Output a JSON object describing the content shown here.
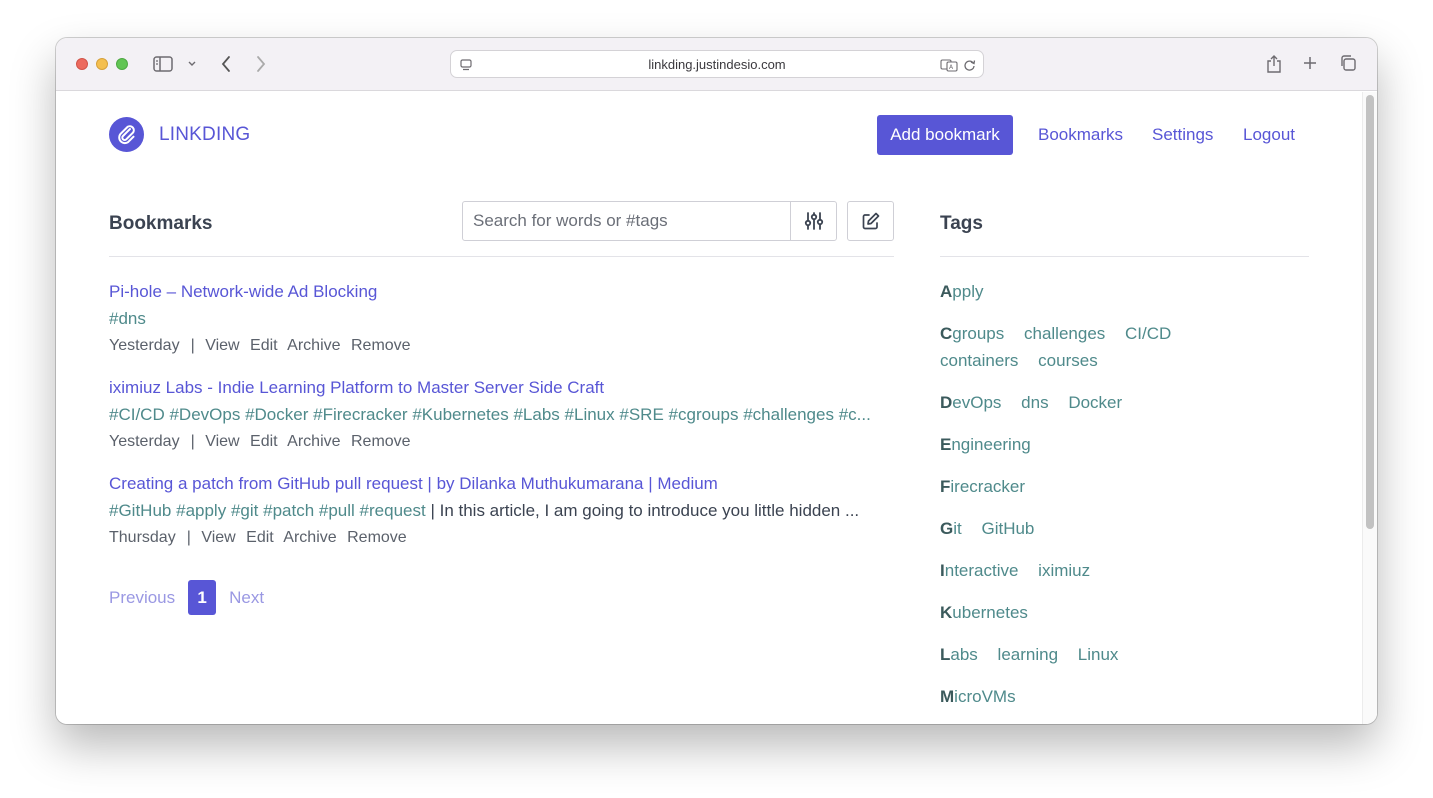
{
  "browser": {
    "url": "linkding.justindesio.com"
  },
  "header": {
    "brand": "LINKDING",
    "add_bookmark": "Add bookmark",
    "nav": [
      "Bookmarks",
      "Settings",
      "Logout"
    ]
  },
  "bookmarks_section": {
    "title": "Bookmarks",
    "search_placeholder": "Search for words or #tags"
  },
  "bookmarks": [
    {
      "title": "Pi-hole – Network-wide Ad Blocking",
      "tags": [
        "#dns"
      ],
      "description": "",
      "date": "Yesterday",
      "actions": [
        "View",
        "Edit",
        "Archive",
        "Remove"
      ]
    },
    {
      "title": "iximiuz Labs - Indie Learning Platform to Master Server Side Craft",
      "tags": [
        "#CI/CD",
        "#DevOps",
        "#Docker",
        "#Firecracker",
        "#Kubernetes",
        "#Labs",
        "#Linux",
        "#SRE",
        "#cgroups",
        "#challenges",
        "#c..."
      ],
      "description": "",
      "date": "Yesterday",
      "actions": [
        "View",
        "Edit",
        "Archive",
        "Remove"
      ]
    },
    {
      "title": "Creating a patch from GitHub pull request | by Dilanka Muthukumarana | Medium",
      "tags": [
        "#GitHub",
        "#apply",
        "#git",
        "#patch",
        "#pull",
        "#request"
      ],
      "description": "| In this article, I am going to introduce you little hidden ...",
      "date": "Thursday",
      "actions": [
        "View",
        "Edit",
        "Archive",
        "Remove"
      ]
    }
  ],
  "pagination": {
    "previous": "Previous",
    "current": "1",
    "next": "Next"
  },
  "tags_section": {
    "title": "Tags",
    "groups": [
      [
        "Apply"
      ],
      [
        "Cgroups",
        "challenges",
        "CI/CD",
        "containers",
        "courses"
      ],
      [
        "DevOps",
        "dns",
        "Docker"
      ],
      [
        "Engineering"
      ],
      [
        "Firecracker"
      ],
      [
        "Git",
        "GitHub"
      ],
      [
        "Interactive",
        "iximiuz"
      ],
      [
        "Kubernetes"
      ],
      [
        "Labs",
        "learning",
        "Linux"
      ],
      [
        "MicroVMs"
      ]
    ]
  },
  "colors": {
    "accent": "#5856d6",
    "tag": "#4f8a8b",
    "text": "#3b4351"
  }
}
